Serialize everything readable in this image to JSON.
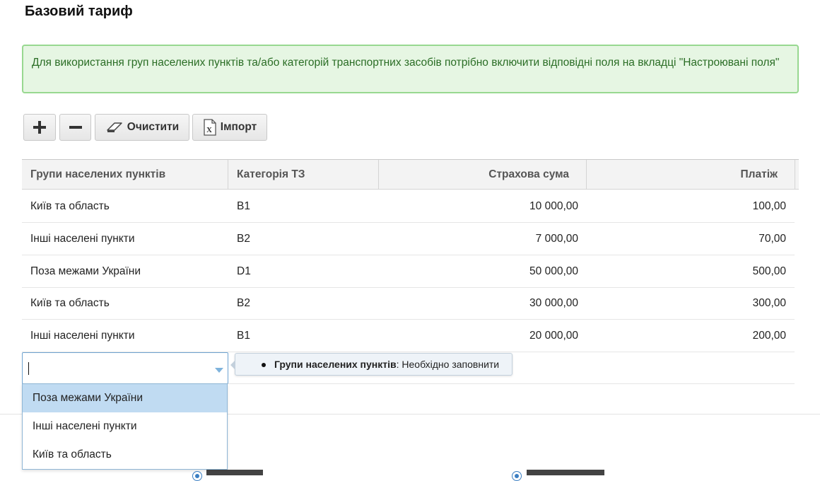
{
  "page": {
    "title": "Базовий тариф"
  },
  "alert": {
    "text": "Для використання груп населених пунктів та/або категорій транспортних засобів потрібно включити відповідні поля на вкладці \"Настроювані поля\""
  },
  "toolbar": {
    "add_icon": "plus-icon",
    "remove_icon": "minus-icon",
    "clear_label": "Очистити",
    "clear_icon": "eraser-icon",
    "import_label": "Імпорт",
    "import_icon": "excel-file-icon"
  },
  "grid": {
    "columns": [
      "Групи населених пунктів",
      "Категорія ТЗ",
      "Страхова сума",
      "Платіж"
    ],
    "rows": [
      {
        "group": "Київ та область",
        "category": "B1",
        "sum": "10 000,00",
        "payment": "100,00"
      },
      {
        "group": "Інші населені пункти",
        "category": "B2",
        "sum": "7 000,00",
        "payment": "70,00"
      },
      {
        "group": "Поза межами України",
        "category": "D1",
        "sum": "50 000,00",
        "payment": "500,00"
      },
      {
        "group": "Київ та область",
        "category": "B2",
        "sum": "30 000,00",
        "payment": "300,00"
      },
      {
        "group": "Інші населені пункти",
        "category": "B1",
        "sum": "20 000,00",
        "payment": "200,00"
      }
    ],
    "edit_row": {
      "value": "",
      "validation_field": "Групи населених пунктів",
      "validation_message": ": Необхідно заповнити"
    }
  },
  "dropdown": {
    "options": [
      "Поза межами України",
      "Інші населені пункти",
      "Київ та область"
    ],
    "selected_index": 0
  },
  "colors": {
    "alert_bg": "#e6f6e3",
    "alert_border": "#98d890",
    "alert_text": "#2a6d25",
    "selection": "#c0dbf2",
    "focus_border": "#6fa4d1"
  }
}
